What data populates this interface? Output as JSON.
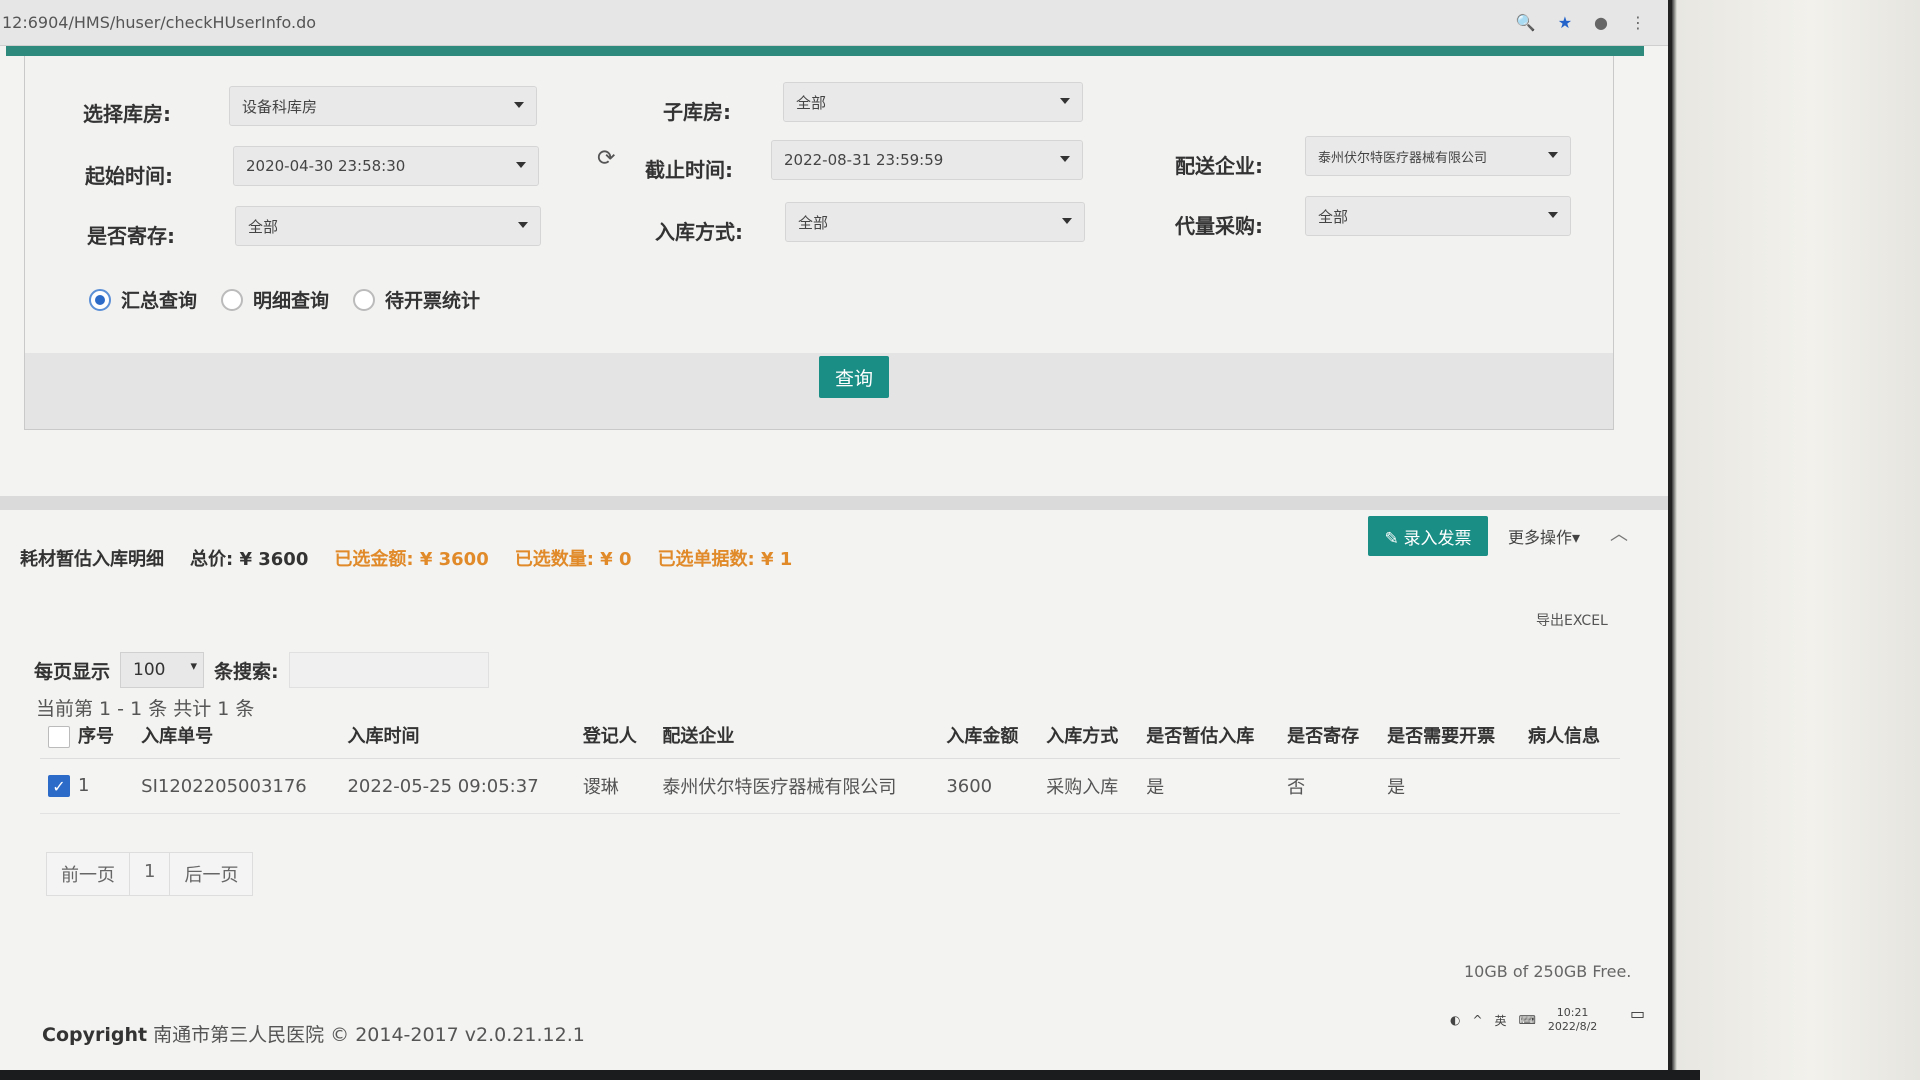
{
  "browser": {
    "url": "12:6904/HMS/huser/checkHUserInfo.do"
  },
  "filters": {
    "warehouse": {
      "label": "选择库房:",
      "value": "设备科库房"
    },
    "sub_warehouse": {
      "label": "子库房:",
      "value": "全部"
    },
    "start_time": {
      "label": "起始时间:",
      "value": "2020-04-30 23:58:30"
    },
    "end_time": {
      "label": "截止时间:",
      "value": "2022-08-31 23:59:59"
    },
    "supplier": {
      "label": "配送企业:",
      "value": "泰州伏尔特医疗器械有限公司"
    },
    "consignment": {
      "label": "是否寄存:",
      "value": "全部"
    },
    "inbound_method": {
      "label": "入库方式:",
      "value": "全部"
    },
    "proxy_purchase": {
      "label": "代量采购:",
      "value": "全部"
    }
  },
  "radios": [
    {
      "label": "汇总查询",
      "checked": true
    },
    {
      "label": "明细查询",
      "checked": false
    },
    {
      "label": "待开票统计",
      "checked": false
    }
  ],
  "query_button": "查询",
  "detail": {
    "title": "耗材暂估入库明细",
    "total": "总价: ¥ 3600",
    "selected_amount": "已选金额: ¥ 3600",
    "selected_qty": "已选数量: ¥ 0",
    "selected_docs": "已选单据数: ¥ 1",
    "invoice_button": "录入发票",
    "more_button": "更多操作▾",
    "export": "导出EXCEL"
  },
  "table_controls": {
    "per_page_label": "每页显示",
    "per_page_value": "100",
    "search_label": "条搜索:",
    "range": "当前第 1 - 1 条   共计 1 条"
  },
  "table": {
    "headers": [
      "序号",
      "入库单号",
      "入库时间",
      "登记人",
      "配送企业",
      "入库金额",
      "入库方式",
      "是否暂估入库",
      "是否寄存",
      "是否需要开票",
      "病人信息"
    ],
    "rows": [
      [
        "1",
        "SI1202205003176",
        "2022-05-25 09:05:37",
        "谡琳",
        "泰州伏尔特医疗器械有限公司",
        "3600",
        "采购入库",
        "是",
        "否",
        "是",
        ""
      ]
    ]
  },
  "pager": {
    "prev": "前一页",
    "page": "1",
    "next": "后一页"
  },
  "footer": {
    "disk": "10GB of 250GB Free.",
    "copyright_label": "Copyright",
    "copyright_text": "南通市第三人民医院 © 2014-2017 v2.0.21.12.1"
  },
  "tray": {
    "lang": "英",
    "time": "10:21",
    "date": "2022/8/2"
  }
}
